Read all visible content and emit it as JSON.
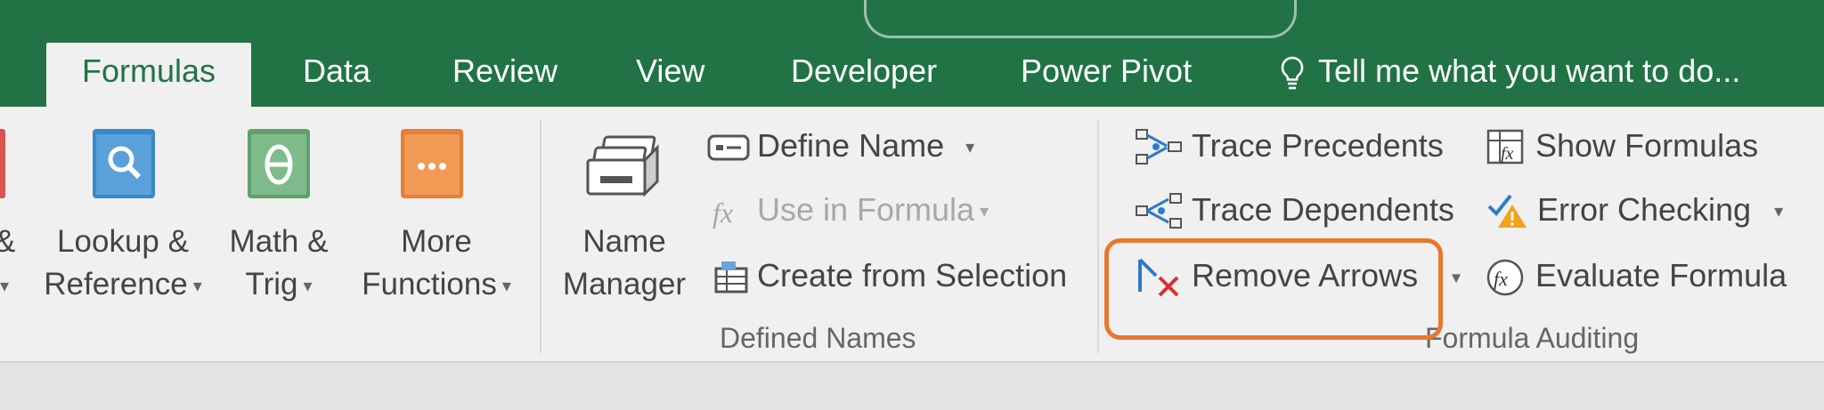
{
  "tabs": [
    {
      "label": "Formulas",
      "active": true
    },
    {
      "label": "Data"
    },
    {
      "label": "Review"
    },
    {
      "label": "View"
    },
    {
      "label": "Developer"
    },
    {
      "label": "Power Pivot"
    }
  ],
  "tell_me": {
    "label": "Tell me what you want to do...",
    "icon": "lightbulb-icon"
  },
  "function_library": {
    "partial": {
      "line1": "&",
      "line2": ""
    },
    "lookup": {
      "line1": "Lookup &",
      "line2": "Reference",
      "icon": "lookup-reference-icon"
    },
    "math": {
      "line1": "Math &",
      "line2": "Trig",
      "icon": "math-trig-icon"
    },
    "more": {
      "line1": "More",
      "line2": "Functions",
      "icon": "more-functions-icon"
    }
  },
  "defined_names": {
    "group_label": "Defined Names",
    "name_manager": {
      "line1": "Name",
      "line2": "Manager",
      "icon": "name-manager-icon"
    },
    "define_name": {
      "label": "Define Name",
      "icon": "define-name-icon"
    },
    "use_in_formula": {
      "label": "Use in Formula",
      "icon": "fx-icon"
    },
    "create_from_selection": {
      "label": "Create from Selection",
      "icon": "create-from-selection-icon"
    }
  },
  "formula_auditing": {
    "group_label": "Formula Auditing",
    "trace_precedents": {
      "label": "Trace Precedents",
      "icon": "trace-precedents-icon"
    },
    "trace_dependents": {
      "label": "Trace Dependents",
      "icon": "trace-dependents-icon"
    },
    "remove_arrows": {
      "label": "Remove Arrows",
      "icon": "remove-arrows-icon"
    },
    "show_formulas": {
      "label": "Show Formulas",
      "icon": "show-formulas-icon"
    },
    "error_checking": {
      "label": "Error Checking",
      "icon": "error-checking-icon"
    },
    "evaluate_formula": {
      "label": "Evaluate Formula",
      "icon": "evaluate-formula-icon"
    }
  },
  "colors": {
    "title_bar": "#217346",
    "highlight": "#e8782d",
    "ribbon": "#f0f0f0"
  }
}
